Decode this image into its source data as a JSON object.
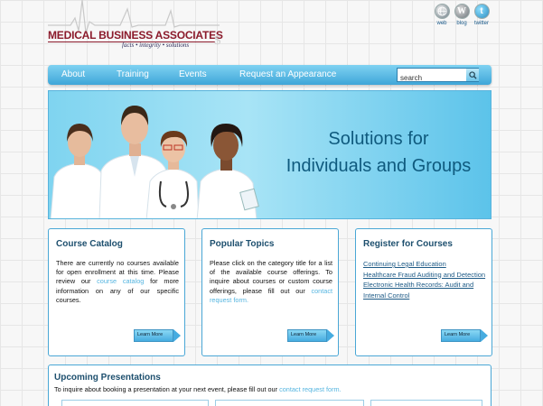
{
  "logo": {
    "title": "MEDICAL BUSINESS ASSOCIATES",
    "tagline": "facts • integrity • solutions",
    "dollar_mark": "$",
    "brand_color": "#8b1a2b"
  },
  "social": {
    "web_label": "web",
    "blog_label": "blog",
    "twitter_label": "twitter"
  },
  "nav": {
    "items": [
      "About",
      "Training",
      "Events",
      "Request an Appearance"
    ],
    "search_value": "search"
  },
  "banner": {
    "heading_line1": "Solutions for",
    "heading_line2": "Individuals and Groups",
    "heading_color": "#0f5a7e"
  },
  "cards": [
    {
      "title": "Course Catalog",
      "text_before": "There are currently no courses available for open enrollment at this time. Please review our ",
      "link": "course catalog",
      "text_after": " for more information on any of our specific courses.",
      "button": "Learn More"
    },
    {
      "title": "Popular Topics",
      "text_before": "Please click on the category title for a list of the available course offerings. To inquire about courses or custom course offerings, please fill out our ",
      "link": "contact request form.",
      "text_after": "",
      "button": "Learn More"
    },
    {
      "title": "Register for Courses",
      "links": [
        "Continuing Legal Education",
        "Healthcare Fraud Auditing and Detection",
        "Electronic Health Records: Audit and Internal Control"
      ],
      "button": "Learn More"
    }
  ],
  "upcoming": {
    "title": "Upcoming Presentations",
    "text": "To inquire about booking a presentation at your next event, please fill out our ",
    "link": "contact request form."
  },
  "colors": {
    "accent": "#46ace0",
    "border": "#4aa7d6",
    "link": "#55b5e0"
  }
}
